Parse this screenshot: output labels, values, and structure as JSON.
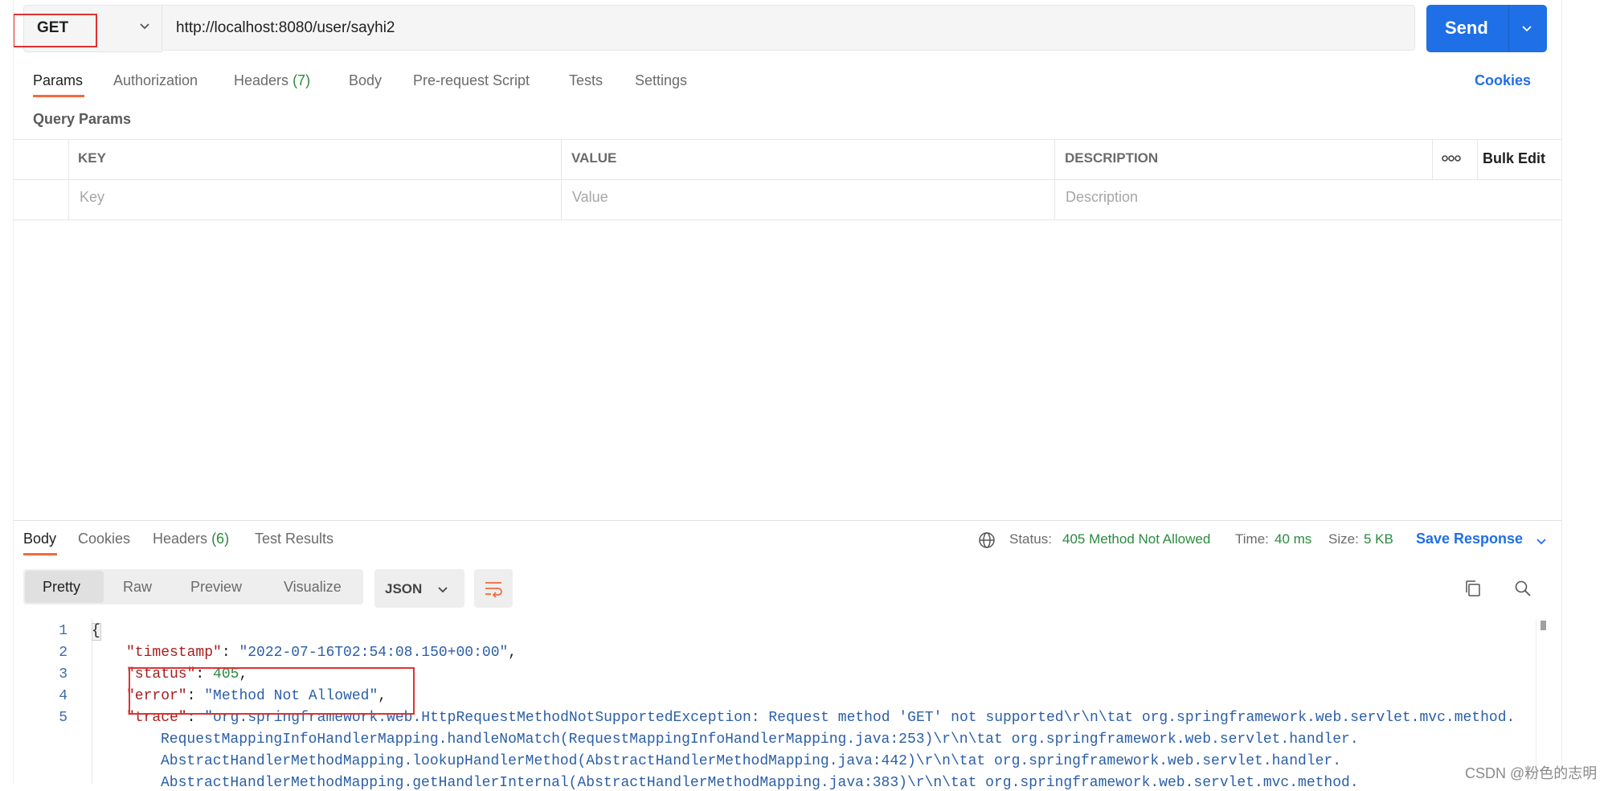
{
  "request": {
    "method": "GET",
    "url": "http://localhost:8080/user/sayhi2",
    "send_label": "Send"
  },
  "request_tabs": {
    "params": "Params",
    "authorization": "Authorization",
    "headers": "Headers",
    "headers_count": "(7)",
    "body": "Body",
    "pre_request": "Pre-request Script",
    "tests": "Tests",
    "settings": "Settings",
    "cookies": "Cookies"
  },
  "query_params": {
    "title": "Query Params",
    "columns": {
      "key": "KEY",
      "value": "VALUE",
      "description": "DESCRIPTION"
    },
    "bulk_edit": "Bulk Edit",
    "placeholders": {
      "key": "Key",
      "value": "Value",
      "description": "Description"
    }
  },
  "response_tabs": {
    "body": "Body",
    "cookies": "Cookies",
    "headers": "Headers",
    "headers_count": "(6)",
    "test_results": "Test Results"
  },
  "response_meta": {
    "status_label": "Status:",
    "status_value": "405 Method Not Allowed",
    "time_label": "Time:",
    "time_value": "40 ms",
    "size_label": "Size:",
    "size_value": "5 KB",
    "save_response": "Save Response"
  },
  "view_modes": {
    "pretty": "Pretty",
    "raw": "Raw",
    "preview": "Preview",
    "visualize": "Visualize",
    "format": "JSON"
  },
  "code": {
    "line_numbers": [
      "1",
      "2",
      "3",
      "4",
      "5"
    ],
    "open_brace": "{",
    "timestamp_key": "\"timestamp\"",
    "timestamp_val": "\"2022-07-16T02:54:08.150+00:00\"",
    "status_key": "\"status\"",
    "status_val": "405",
    "error_key": "\"error\"",
    "error_val": "\"Method Not Allowed\"",
    "trace_key": "\"trace\"",
    "trace_line1": "\"org.springframework.web.HttpRequestMethodNotSupportedException: Request method 'GET' not supported\\r\\n\\tat org.springframework.web.servlet.mvc.method.",
    "trace_line2": "RequestMappingInfoHandlerMapping.handleNoMatch(RequestMappingInfoHandlerMapping.java:253)\\r\\n\\tat org.springframework.web.servlet.handler.",
    "trace_line3": "AbstractHandlerMethodMapping.lookupHandlerMethod(AbstractHandlerMethodMapping.java:442)\\r\\n\\tat org.springframework.web.servlet.handler.",
    "trace_line4": "AbstractHandlerMethodMapping.getHandlerInternal(AbstractHandlerMethodMapping.java:383)\\r\\n\\tat org.springframework.web.servlet.mvc.method."
  },
  "watermark": "CSDN @粉色的志明",
  "colors": {
    "accent": "#f26b3a",
    "send": "#1f6fe6",
    "highlight": "#e03131",
    "ok_green": "#2b8a3e"
  }
}
